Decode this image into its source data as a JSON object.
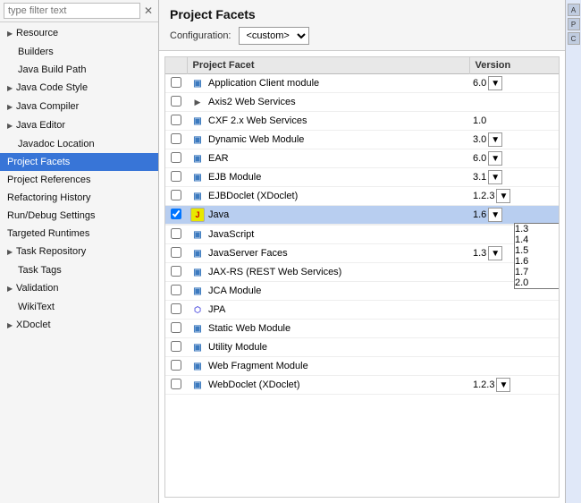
{
  "sidebar": {
    "search_placeholder": "type filter text",
    "items": [
      {
        "id": "resource",
        "label": "Resource",
        "indent": 1,
        "arrow": "▶",
        "selected": false
      },
      {
        "id": "builders",
        "label": "Builders",
        "indent": 2,
        "arrow": "",
        "selected": false
      },
      {
        "id": "java-build-path",
        "label": "Java Build Path",
        "indent": 2,
        "arrow": "",
        "selected": false
      },
      {
        "id": "java-code-style",
        "label": "Java Code Style",
        "indent": 1,
        "arrow": "▶",
        "selected": false
      },
      {
        "id": "java-compiler",
        "label": "Java Compiler",
        "indent": 1,
        "arrow": "▶",
        "selected": false
      },
      {
        "id": "java-editor",
        "label": "Java Editor",
        "indent": 1,
        "arrow": "▶",
        "selected": false
      },
      {
        "id": "javadoc-location",
        "label": "Javadoc Location",
        "indent": 2,
        "arrow": "",
        "selected": false
      },
      {
        "id": "project-facets",
        "label": "Project Facets",
        "indent": 1,
        "arrow": "",
        "selected": true
      },
      {
        "id": "project-references",
        "label": "Project References",
        "indent": 1,
        "arrow": "",
        "selected": false
      },
      {
        "id": "refactoring-history",
        "label": "Refactoring History",
        "indent": 1,
        "arrow": "",
        "selected": false
      },
      {
        "id": "run-debug-settings",
        "label": "Run/Debug Settings",
        "indent": 1,
        "arrow": "",
        "selected": false
      },
      {
        "id": "targeted-runtimes",
        "label": "Targeted Runtimes",
        "indent": 1,
        "arrow": "",
        "selected": false
      },
      {
        "id": "task-repository",
        "label": "Task Repository",
        "indent": 1,
        "arrow": "▶",
        "selected": false
      },
      {
        "id": "task-tags",
        "label": "Task Tags",
        "indent": 2,
        "arrow": "",
        "selected": false
      },
      {
        "id": "validation",
        "label": "Validation",
        "indent": 1,
        "arrow": "▶",
        "selected": false
      },
      {
        "id": "wikitext",
        "label": "WikiText",
        "indent": 2,
        "arrow": "",
        "selected": false
      },
      {
        "id": "xdoclet",
        "label": "XDoclet",
        "indent": 1,
        "arrow": "▶",
        "selected": false
      }
    ]
  },
  "main": {
    "title": "Project Facets",
    "config_label": "Configuration:",
    "config_value": "<custom>",
    "table": {
      "col_facet": "Project Facet",
      "col_version": "Version",
      "rows": [
        {
          "id": "app-client",
          "checked": false,
          "icon": "module",
          "icon_text": "▣",
          "name": "Application Client module",
          "version": "6.0",
          "has_dropdown": true,
          "indent": false
        },
        {
          "id": "axis2",
          "checked": false,
          "icon": "arrow-expand",
          "icon_text": "▶",
          "name": "Axis2 Web Services",
          "version": "",
          "has_dropdown": false,
          "indent": false
        },
        {
          "id": "cxf",
          "checked": false,
          "icon": "module",
          "icon_text": "▣",
          "name": "CXF 2.x Web Services",
          "version": "1.0",
          "has_dropdown": false,
          "indent": false
        },
        {
          "id": "dynamic-web",
          "checked": false,
          "icon": "module",
          "icon_text": "▣",
          "name": "Dynamic Web Module",
          "version": "3.0",
          "has_dropdown": true,
          "indent": false
        },
        {
          "id": "ear",
          "checked": false,
          "icon": "module",
          "icon_text": "▣",
          "name": "EAR",
          "version": "6.0",
          "has_dropdown": true,
          "indent": false
        },
        {
          "id": "ejb",
          "checked": false,
          "icon": "module",
          "icon_text": "▣",
          "name": "EJB Module",
          "version": "3.1",
          "has_dropdown": true,
          "indent": false
        },
        {
          "id": "ejbdoclet",
          "checked": false,
          "icon": "module",
          "icon_text": "▣",
          "name": "EJBDoclet (XDoclet)",
          "version": "1.2.3",
          "has_dropdown": true,
          "indent": false
        },
        {
          "id": "java",
          "checked": true,
          "icon": "java-icon",
          "icon_text": "J",
          "name": "Java",
          "version": "1.6",
          "has_dropdown": true,
          "indent": false,
          "selected": true
        },
        {
          "id": "javascript",
          "checked": false,
          "icon": "module",
          "icon_text": "▣",
          "name": "JavaScript",
          "version": "",
          "has_dropdown": false,
          "indent": false
        },
        {
          "id": "jsf",
          "checked": false,
          "icon": "module",
          "icon_text": "▣",
          "name": "JavaServer Faces",
          "version": "1.3",
          "has_dropdown": true,
          "indent": false
        },
        {
          "id": "jax-rs",
          "checked": false,
          "icon": "module",
          "icon_text": "▣",
          "name": "JAX-RS (REST Web Services)",
          "version": "",
          "has_dropdown": false,
          "indent": false
        },
        {
          "id": "jca",
          "checked": false,
          "icon": "module",
          "icon_text": "▣",
          "name": "JCA Module",
          "version": "",
          "has_dropdown": false,
          "indent": false
        },
        {
          "id": "jpa",
          "checked": false,
          "icon": "jpa-icon",
          "icon_text": "⬡",
          "name": "JPA",
          "version": "",
          "has_dropdown": false,
          "indent": false
        },
        {
          "id": "static-web",
          "checked": false,
          "icon": "module",
          "icon_text": "▣",
          "name": "Static Web Module",
          "version": "",
          "has_dropdown": false,
          "indent": false
        },
        {
          "id": "utility",
          "checked": false,
          "icon": "module",
          "icon_text": "▣",
          "name": "Utility Module",
          "version": "",
          "has_dropdown": false,
          "indent": false
        },
        {
          "id": "web-fragment",
          "checked": false,
          "icon": "module",
          "icon_text": "▣",
          "name": "Web Fragment Module",
          "version": "",
          "has_dropdown": false,
          "indent": false
        },
        {
          "id": "webdoclet",
          "checked": false,
          "icon": "module",
          "icon_text": "▣",
          "name": "WebDoclet (XDoclet)",
          "version": "1.2.3",
          "has_dropdown": true,
          "indent": false
        }
      ]
    }
  },
  "dropdown_popup": {
    "visible": true,
    "options": [
      {
        "value": "1.3",
        "label": "1.3",
        "selected": false
      },
      {
        "value": "1.4",
        "label": "1.4",
        "selected": false
      },
      {
        "value": "1.5",
        "label": "1.5",
        "selected": false
      },
      {
        "value": "1.6",
        "label": "1.6",
        "selected": true
      },
      {
        "value": "1.7",
        "label": "1.7",
        "selected": false
      },
      {
        "value": "2.0",
        "label": "2.0",
        "selected": false
      }
    ]
  },
  "right_panel": {
    "btn_labels": [
      "A",
      "P",
      "C"
    ]
  }
}
